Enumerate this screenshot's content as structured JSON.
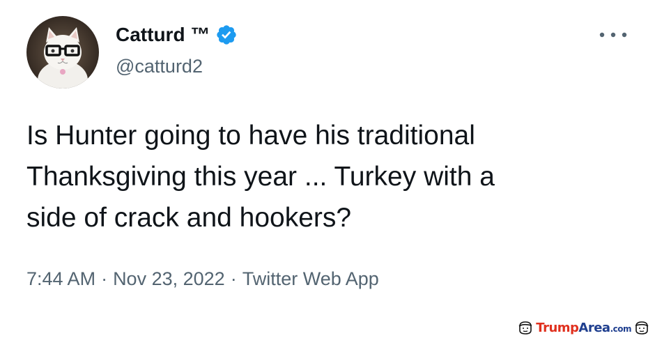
{
  "tweet": {
    "author": {
      "display_name": "Catturd ™",
      "handle": "@catturd2",
      "verified": true,
      "avatar_icon": "cat-with-glasses-avatar"
    },
    "text_lines": [
      "Is Hunter going to have his traditional",
      "Thanksgiving this year ... Turkey with a",
      "side of crack and hookers?"
    ],
    "meta": {
      "time": "7:44 AM",
      "separator": "·",
      "date": "Nov 23, 2022",
      "source": "Twitter Web App"
    },
    "more_icon": "more-horizontal-icon"
  },
  "watermark": {
    "brand_trump": "Trump",
    "brand_area": "Area",
    "brand_tld": ".com"
  },
  "colors": {
    "text_primary": "#0f1419",
    "text_secondary": "#536471",
    "verified_blue": "#1d9bf0",
    "watermark_red": "#e0301e",
    "watermark_blue": "#1f3f8f"
  }
}
